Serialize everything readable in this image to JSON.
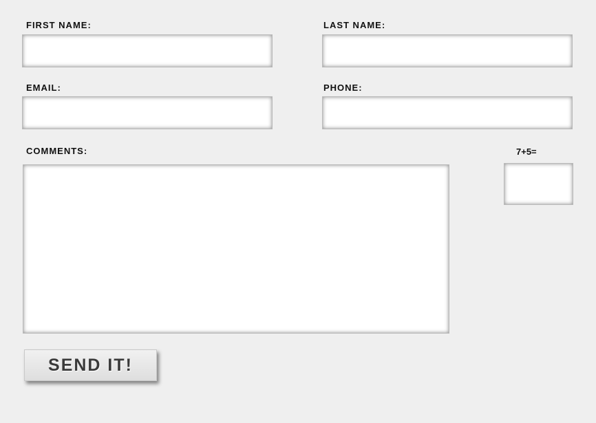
{
  "form": {
    "first_name": {
      "label": "FIRST NAME:",
      "value": "",
      "placeholder": ""
    },
    "last_name": {
      "label": "LAST NAME:",
      "value": "",
      "placeholder": ""
    },
    "email": {
      "label": "EMAIL:",
      "value": "",
      "placeholder": ""
    },
    "phone": {
      "label": "PHONE:",
      "value": "",
      "placeholder": ""
    },
    "comments": {
      "label": "COMMENTS:",
      "value": "",
      "placeholder": ""
    },
    "captcha": {
      "label": "7+5=",
      "value": "",
      "placeholder": ""
    },
    "submit_label": "SEND IT!"
  },
  "colors": {
    "background": "#efefef",
    "field_background": "#ffffff",
    "label_text": "#111111",
    "button_text": "#3a3a3a"
  }
}
